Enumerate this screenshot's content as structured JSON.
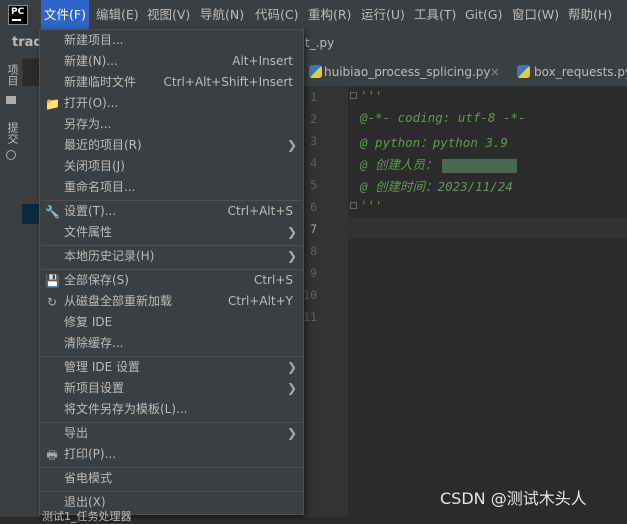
{
  "app": {
    "logo_text": "PC",
    "project_name": "tradi"
  },
  "menubar": {
    "items": [
      {
        "label": "文件(F)"
      },
      {
        "label": "编辑(E)"
      },
      {
        "label": "视图(V)"
      },
      {
        "label": "导航(N)"
      },
      {
        "label": "代码(C)"
      },
      {
        "label": "重构(R)"
      },
      {
        "label": "运行(U)"
      },
      {
        "label": "工具(T)"
      },
      {
        "label": "Git(G)"
      },
      {
        "label": "窗口(W)"
      },
      {
        "label": "帮助(H)"
      }
    ]
  },
  "sidebar": {
    "project_label": "项目",
    "commit_label": "提交"
  },
  "tabs": {
    "partial_tab": "t_.py",
    "tab1": "huibiao_process_splicing.py",
    "tab1_close": "×",
    "tab2": "box_requests.py"
  },
  "editor": {
    "line_numbers": [
      "1",
      "2",
      "3",
      "4",
      "5",
      "6",
      "7",
      "8",
      "9",
      "10",
      "11"
    ],
    "current_line": "7",
    "lines": [
      "'''",
      "@-*- coding: utf-8 -*-",
      "@ python：python 3.9",
      "@ 创建人员：",
      "@ 创建时间：2023/11/24",
      "'''"
    ]
  },
  "file_menu": {
    "items": [
      {
        "label": "新建项目...",
        "shortcut": "",
        "icon": "",
        "submenu": false
      },
      {
        "label": "新建(N)...",
        "shortcut": "Alt+Insert",
        "icon": "",
        "submenu": false
      },
      {
        "label": "新建临时文件",
        "shortcut": "Ctrl+Alt+Shift+Insert",
        "icon": "",
        "submenu": false
      },
      {
        "label": "打开(O)...",
        "shortcut": "",
        "icon": "folder-icon",
        "submenu": false
      },
      {
        "label": "另存为...",
        "shortcut": "",
        "icon": "",
        "submenu": false
      },
      {
        "label": "最近的项目(R)",
        "shortcut": "",
        "icon": "",
        "submenu": true
      },
      {
        "label": "关闭项目(J)",
        "shortcut": "",
        "icon": "",
        "submenu": false
      },
      {
        "label": "重命名项目...",
        "shortcut": "",
        "icon": "",
        "submenu": false
      },
      {
        "label": "设置(T)...",
        "shortcut": "Ctrl+Alt+S",
        "icon": "wrench-icon",
        "submenu": false
      },
      {
        "label": "文件属性",
        "shortcut": "",
        "icon": "",
        "submenu": true
      },
      {
        "label": "本地历史记录(H)",
        "shortcut": "",
        "icon": "",
        "submenu": true
      },
      {
        "label": "全部保存(S)",
        "shortcut": "Ctrl+S",
        "icon": "save-icon",
        "submenu": false
      },
      {
        "label": "从磁盘全部重新加载",
        "shortcut": "Ctrl+Alt+Y",
        "icon": "reload-icon",
        "submenu": false
      },
      {
        "label": "修复 IDE",
        "shortcut": "",
        "icon": "",
        "submenu": false
      },
      {
        "label": "清除缓存...",
        "shortcut": "",
        "icon": "",
        "submenu": false
      },
      {
        "label": "管理 IDE 设置",
        "shortcut": "",
        "icon": "",
        "submenu": true
      },
      {
        "label": "新项目设置",
        "shortcut": "",
        "icon": "",
        "submenu": true
      },
      {
        "label": "将文件另存为模板(L)...",
        "shortcut": "",
        "icon": "",
        "submenu": false
      },
      {
        "label": "导出",
        "shortcut": "",
        "icon": "",
        "submenu": true
      },
      {
        "label": "打印(P)...",
        "shortcut": "",
        "icon": "print-icon",
        "submenu": false
      },
      {
        "label": "省电模式",
        "shortcut": "",
        "icon": "",
        "submenu": false
      },
      {
        "label": "退出(X)",
        "shortcut": "",
        "icon": "",
        "submenu": false
      }
    ]
  },
  "watermark": "CSDN @测试木头人",
  "bottom_partial_text": "测试1_任务处理器",
  "colors": {
    "accent": "#2f65ca",
    "menu_bg": "#3c3f41",
    "editor_bg": "#2b2b2b",
    "doc_comment": "#629755"
  }
}
